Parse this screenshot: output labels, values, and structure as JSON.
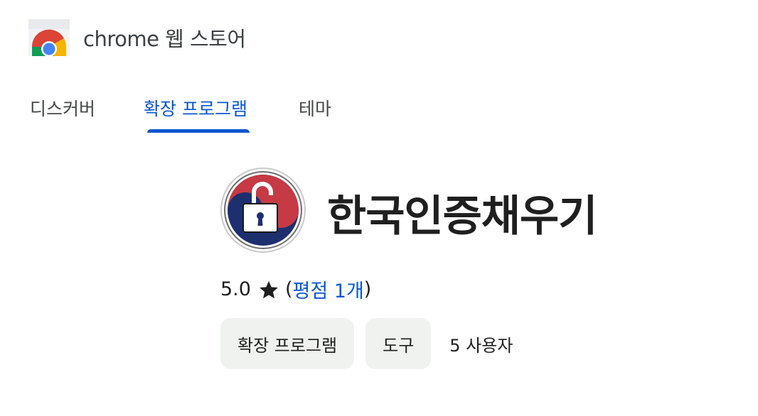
{
  "header": {
    "title": "chrome 웹 스토어",
    "logo_icon": "chrome-web-store-icon"
  },
  "tabs": [
    {
      "label": "디스커버",
      "active": false
    },
    {
      "label": "확장 프로그램",
      "active": true
    },
    {
      "label": "테마",
      "active": false
    }
  ],
  "extension": {
    "name": "한국인증채우기",
    "icon": "unlocked-padlock-icon",
    "rating": "5.0",
    "rating_icon": "star-icon",
    "rating_count_label": "평점 1개",
    "categories": [
      "확장 프로그램",
      "도구"
    ],
    "users_label": "5 사용자"
  },
  "colors": {
    "accent": "#0b57d0",
    "chip_bg": "#f0f2f0",
    "text": "#1f1f1f",
    "icon_red": "#c53a44",
    "icon_navy": "#1d2f6f"
  }
}
